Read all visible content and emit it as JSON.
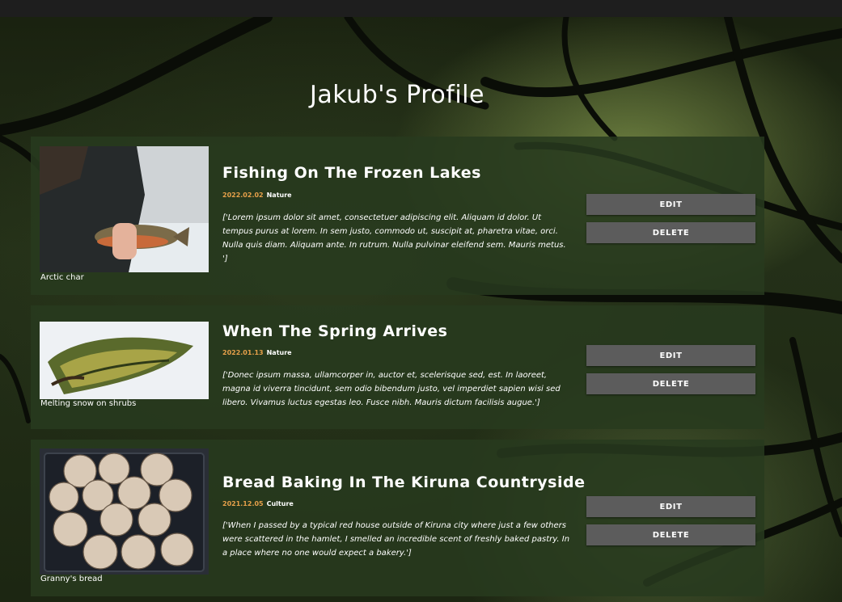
{
  "page": {
    "title": "Jakub's Profile"
  },
  "posts": [
    {
      "title": "Fishing On The Frozen Lakes",
      "date": "2022.02.02",
      "category": "Nature",
      "body": "['Lorem ipsum dolor sit amet, consectetuer adipiscing elit. Aliquam id dolor. Ut tempus purus at lorem. In sem justo, commodo ut, suscipit at, pharetra vitae, orci. Nulla quis diam. Aliquam ante. In rutrum. Nulla pulvinar eleifend sem. Mauris metus. ']",
      "image_caption": "Arctic char",
      "edit_label": "EDIT",
      "delete_label": "DELETE"
    },
    {
      "title": "When The Spring Arrives",
      "date": "2022.01.13",
      "category": "Nature",
      "body": "['Donec ipsum massa, ullamcorper in, auctor et, scelerisque sed, est. In laoreet, magna id viverra tincidunt, sem odio bibendum justo, vel imperdiet sapien wisi sed libero. Vivamus luctus egestas leo. Fusce nibh. Mauris dictum facilisis augue.']",
      "image_caption": "Melting snow on shrubs",
      "edit_label": "EDIT",
      "delete_label": "DELETE"
    },
    {
      "title": "Bread Baking In The Kiruna Countryside",
      "date": "2021.12.05",
      "category": "Culture",
      "body": "['When I passed by a typical red house outside of Kiruna city where just a few others were scattered in the hamlet, I smelled an incredible scent of freshly baked pastry. In a place where no one would expect a bakery.']",
      "image_caption": "Granny's bread",
      "edit_label": "EDIT",
      "delete_label": "DELETE"
    }
  ],
  "colors": {
    "card_bg": "#283a1e",
    "button_bg": "#5c5c5c",
    "date_accent": "#e6a04a",
    "topbar": "#1e1e1e"
  }
}
